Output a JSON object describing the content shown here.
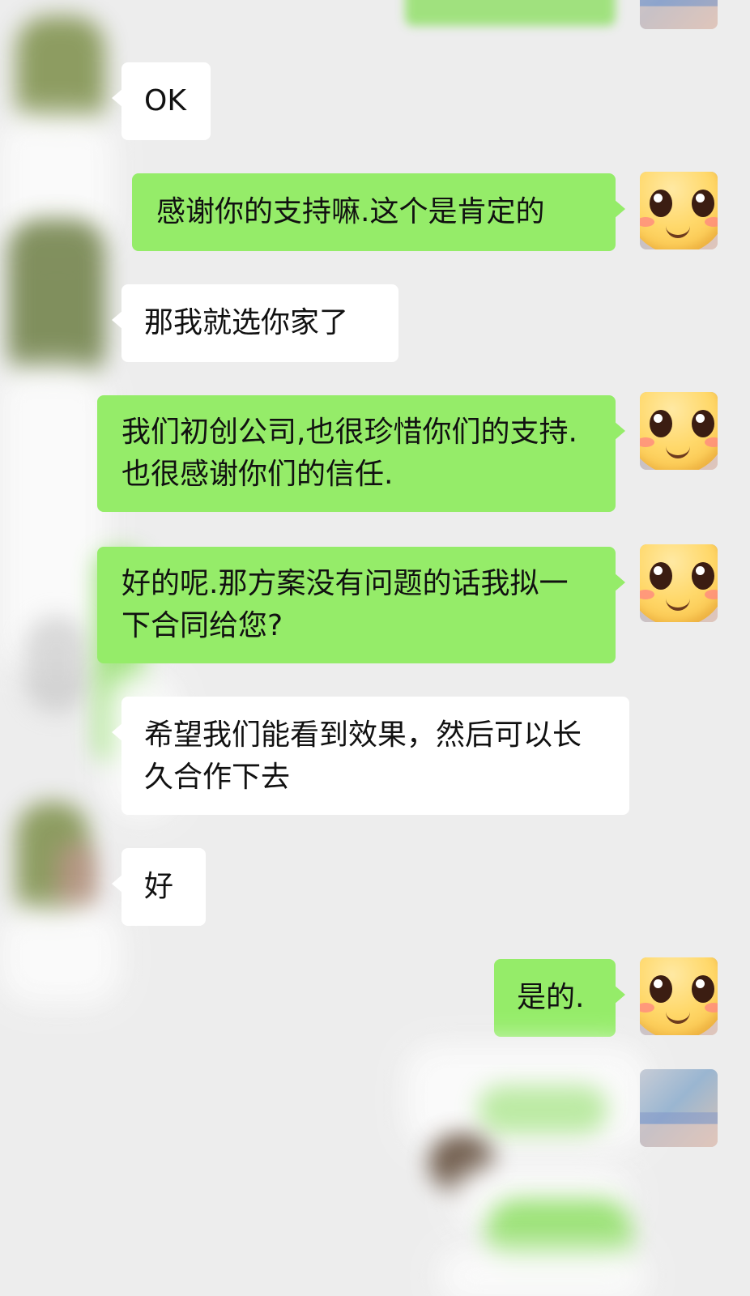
{
  "chat": {
    "messages": [
      {
        "side": "them",
        "text": "OK"
      },
      {
        "side": "me",
        "text": "感谢你的支持嘛.这个是肯定的"
      },
      {
        "side": "them",
        "text": "那我就选你家了"
      },
      {
        "side": "me",
        "text": "我们初创公司,也很珍惜你们的支持.也很感谢你们的信任."
      },
      {
        "side": "me",
        "text": "好的呢.那方案没有问题的话我拟一下合同给您?"
      },
      {
        "side": "them",
        "text": "希望我们能看到效果，然后可以长久合作下去"
      },
      {
        "side": "them",
        "text": "好"
      },
      {
        "side": "me",
        "text": "是的."
      }
    ]
  },
  "colors": {
    "background": "#ededed",
    "my_bubble": "#95ec69",
    "their_bubble": "#ffffff"
  },
  "icons": {
    "my_avatar": "smiling-emoji-avatar-icon",
    "their_avatar": "blurred-avatar"
  }
}
